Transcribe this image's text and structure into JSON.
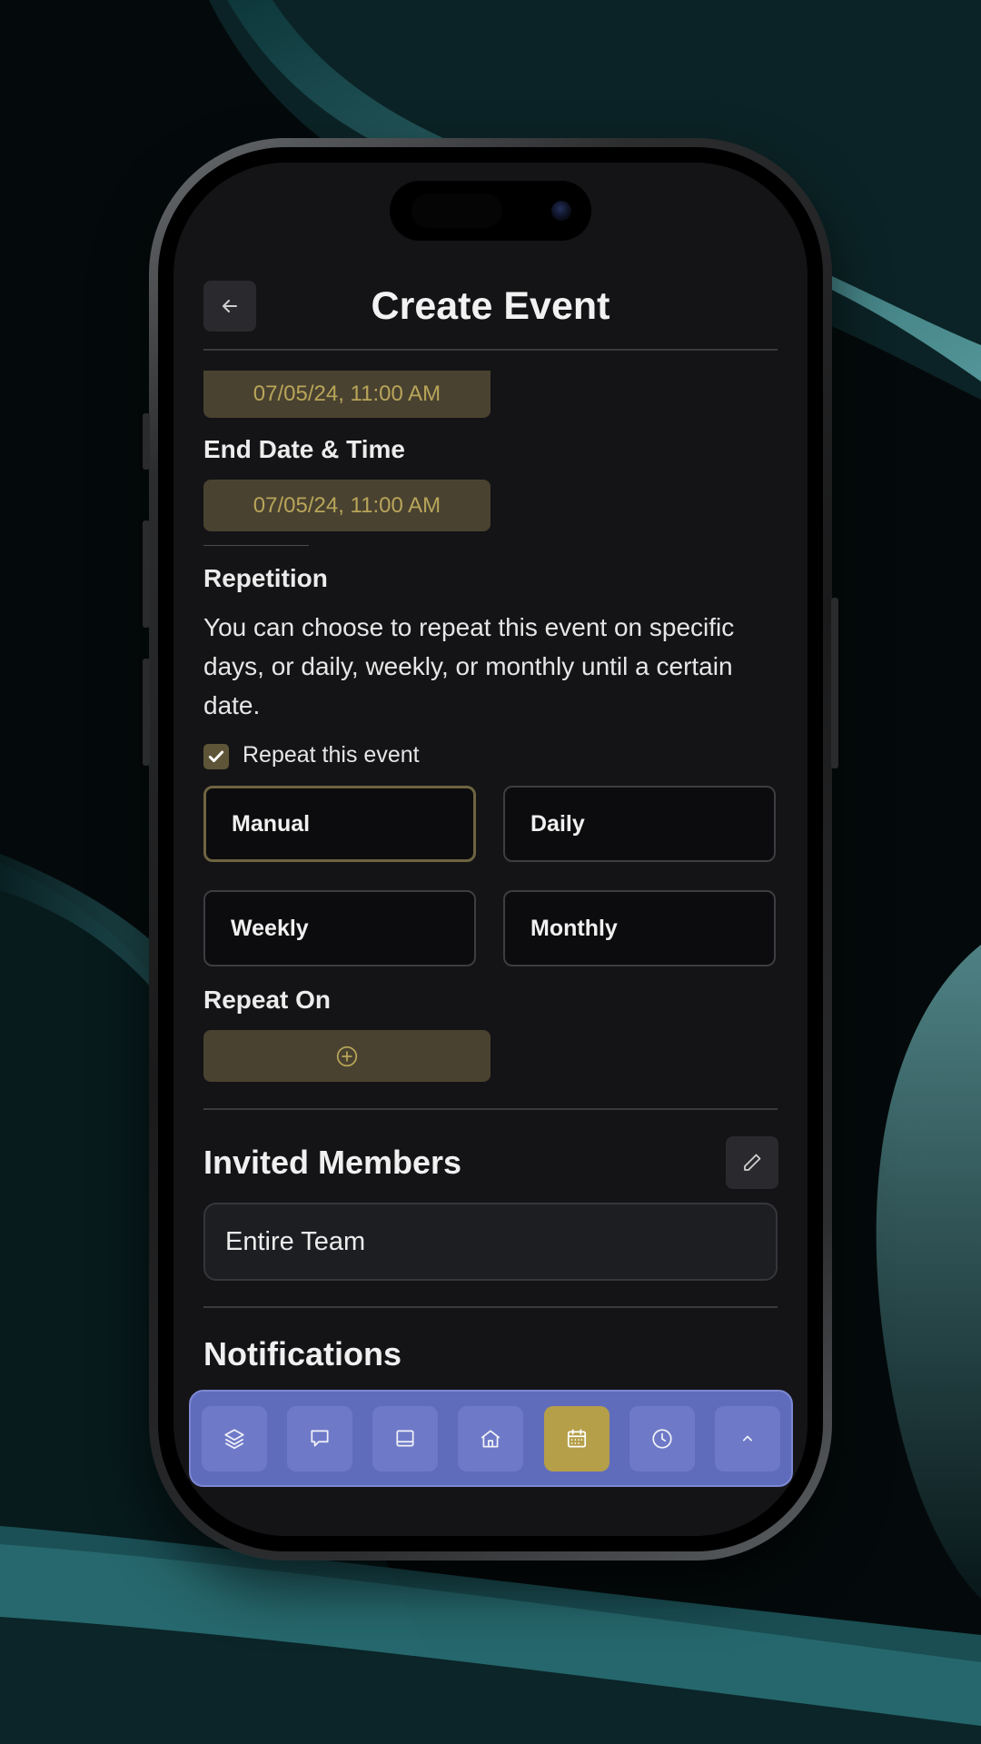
{
  "header": {
    "title": "Create Event",
    "back_icon": "arrow-left-icon"
  },
  "start": {
    "value": "07/05/24, 11:00 AM"
  },
  "end": {
    "label": "End Date & Time",
    "value": "07/05/24, 11:00 AM"
  },
  "repetition": {
    "label": "Repetition",
    "description": "You can choose to repeat this event on specific days, or daily, weekly, or monthly until a certain date.",
    "checkbox_label": "Repeat this event",
    "checked": true,
    "options": [
      "Manual",
      "Daily",
      "Weekly",
      "Monthly"
    ],
    "selected": "Manual",
    "repeat_on_label": "Repeat On",
    "add_icon": "plus-circle-icon"
  },
  "members": {
    "title": "Invited Members",
    "value": "Entire Team",
    "edit_icon": "pencil-icon"
  },
  "notifications": {
    "title": "Notifications"
  },
  "bottom_nav": {
    "items": [
      "layers-icon",
      "chat-icon",
      "tablet-icon",
      "home-icon",
      "calendar-icon",
      "clock-icon",
      "chevron-up-icon"
    ],
    "active": "calendar-icon"
  },
  "colors": {
    "accent": "#b59f48",
    "nav_bg": "#5f6cbc",
    "screen_bg": "#141416",
    "date_button_bg": "#4a4230"
  }
}
